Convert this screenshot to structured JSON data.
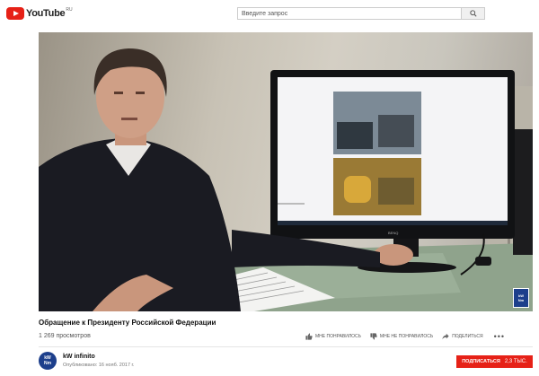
{
  "header": {
    "logo_text": "YouTube",
    "logo_region": "RU",
    "search_placeholder": "Введите запрос"
  },
  "video": {
    "title": "Обращение к Президенту Российской Федерации",
    "views": "1 269 просмотров"
  },
  "actions": {
    "like": "МНЕ ПОНРАВИЛОСЬ",
    "dislike": "МНЕ НЕ ПОНРАВИЛОСЬ",
    "share": "ПОДЕЛИТЬСЯ",
    "more": "•••"
  },
  "channel": {
    "avatar_line1": "kW",
    "avatar_line2": "Nm",
    "name": "kW infinito",
    "published": "Опубликовано: 16 нояб. 2017 г.",
    "subscribe_label": "ПОДПИСАТЬСЯ",
    "subscribers": "2,3 ТЫС."
  },
  "watermark": {
    "line1": "kW",
    "line2": "Nm"
  },
  "colors": {
    "brand_red": "#e62117",
    "channel_blue": "#1d3f8c"
  }
}
